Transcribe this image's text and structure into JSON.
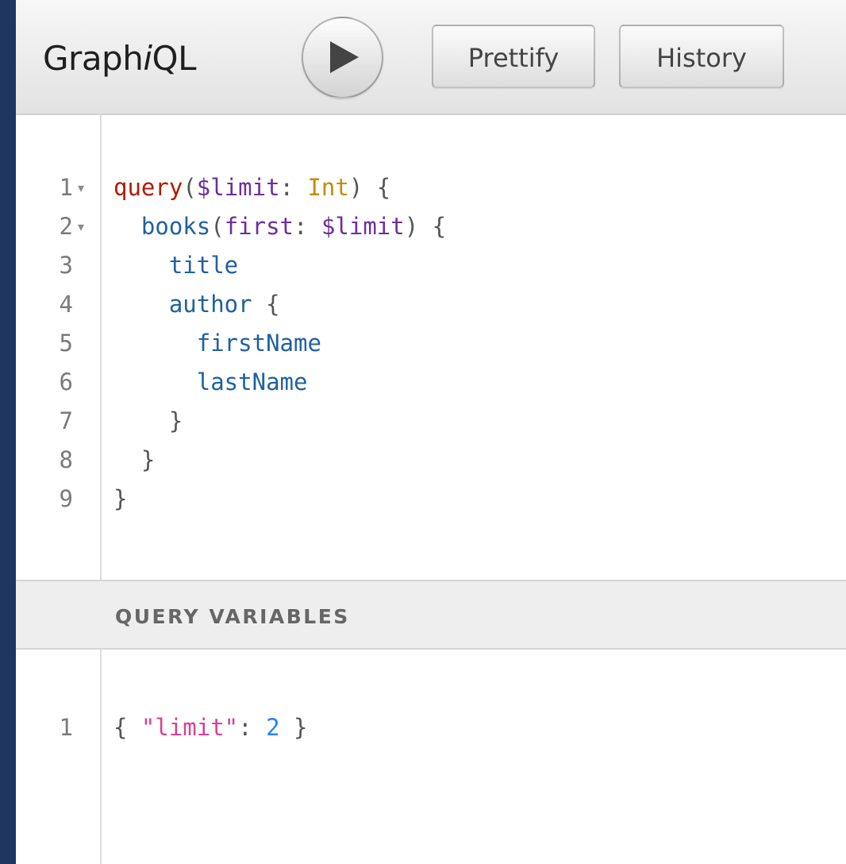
{
  "toolbar": {
    "title_prefix": "Graph",
    "title_italic": "i",
    "title_suffix": "QL",
    "prettify_label": "Prettify",
    "history_label": "History"
  },
  "query_editor": {
    "lines": [
      {
        "number": "1",
        "foldable": true,
        "tokens": [
          {
            "t": "query",
            "k": "kw"
          },
          {
            "t": "(",
            "k": "punct"
          },
          {
            "t": "$limit",
            "k": "var"
          },
          {
            "t": ": ",
            "k": "punct"
          },
          {
            "t": "Int",
            "k": "type"
          },
          {
            "t": ") {",
            "k": "punct"
          }
        ]
      },
      {
        "number": "2",
        "foldable": true,
        "tokens": [
          {
            "t": "  ",
            "k": "punct"
          },
          {
            "t": "books",
            "k": "field"
          },
          {
            "t": "(",
            "k": "punct"
          },
          {
            "t": "first",
            "k": "var"
          },
          {
            "t": ": ",
            "k": "punct"
          },
          {
            "t": "$limit",
            "k": "var"
          },
          {
            "t": ") {",
            "k": "punct"
          }
        ]
      },
      {
        "number": "3",
        "foldable": false,
        "tokens": [
          {
            "t": "    ",
            "k": "punct"
          },
          {
            "t": "title",
            "k": "field"
          }
        ]
      },
      {
        "number": "4",
        "foldable": false,
        "tokens": [
          {
            "t": "    ",
            "k": "punct"
          },
          {
            "t": "author",
            "k": "field"
          },
          {
            "t": " {",
            "k": "punct"
          }
        ]
      },
      {
        "number": "5",
        "foldable": false,
        "tokens": [
          {
            "t": "      ",
            "k": "punct"
          },
          {
            "t": "firstName",
            "k": "field"
          }
        ]
      },
      {
        "number": "6",
        "foldable": false,
        "tokens": [
          {
            "t": "      ",
            "k": "punct"
          },
          {
            "t": "lastName",
            "k": "field"
          }
        ]
      },
      {
        "number": "7",
        "foldable": false,
        "tokens": [
          {
            "t": "    }",
            "k": "punct"
          }
        ]
      },
      {
        "number": "8",
        "foldable": false,
        "tokens": [
          {
            "t": "  }",
            "k": "punct"
          }
        ]
      },
      {
        "number": "9",
        "foldable": false,
        "tokens": [
          {
            "t": "}",
            "k": "punct"
          }
        ]
      }
    ]
  },
  "variables": {
    "title": "QUERY VARIABLES",
    "lines": [
      {
        "number": "1",
        "foldable": false,
        "tokens": [
          {
            "t": "{ ",
            "k": "punct"
          },
          {
            "t": "\"limit\"",
            "k": "str"
          },
          {
            "t": ": ",
            "k": "punct"
          },
          {
            "t": "2",
            "k": "num"
          },
          {
            "t": " }",
            "k": "punct"
          }
        ]
      }
    ]
  },
  "colors": {
    "keyword": "#b11a04",
    "variable": "#6e2e9c",
    "type": "#c58c00",
    "field": "#1f61a0",
    "string": "#d64292",
    "number": "#2882f9"
  },
  "icons": {
    "run": "play-icon"
  }
}
